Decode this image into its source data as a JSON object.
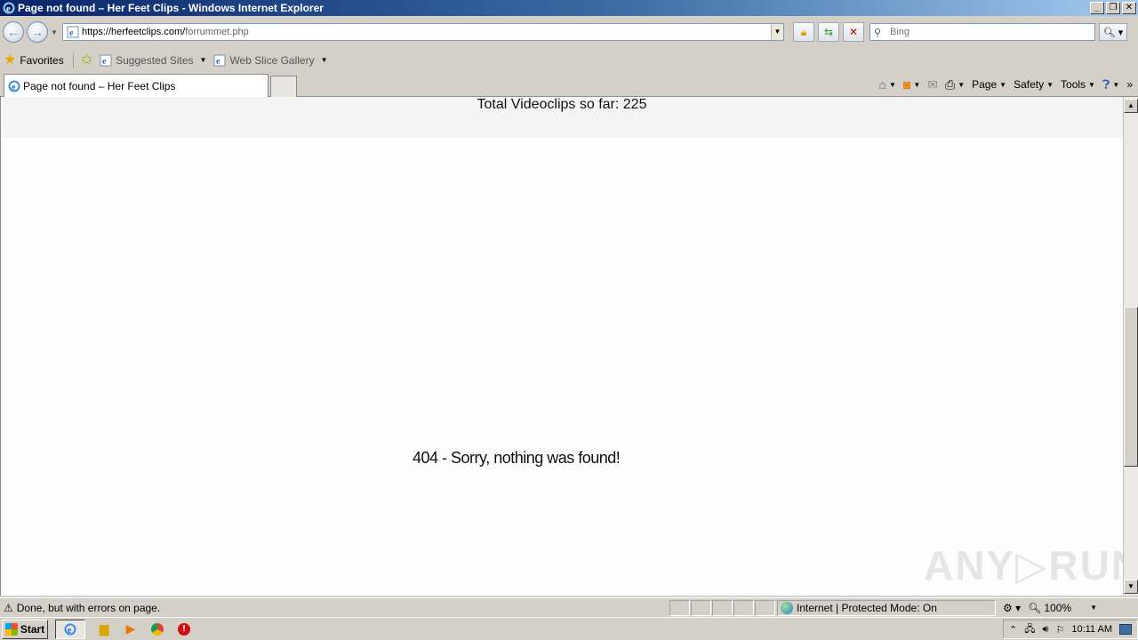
{
  "window": {
    "title": "Page not found – Her Feet Clips - Windows Internet Explorer"
  },
  "address_bar": {
    "url_host": "https://herfeetclips.com/",
    "url_path": "forrummet.php"
  },
  "search": {
    "placeholder": "Bing"
  },
  "favorites_bar": {
    "favorites_label": "Favorites",
    "suggested_sites": "Suggested Sites",
    "web_slice_gallery": "Web Slice Gallery"
  },
  "tab": {
    "title": "Page not found – Her Feet Clips"
  },
  "command_bar": {
    "page": "Page",
    "safety": "Safety",
    "tools": "Tools"
  },
  "content": {
    "total_clips": "Total Videoclips so far: 225",
    "not_found": "404 - Sorry, nothing was found!"
  },
  "watermark": "ANY▷RUN",
  "status_bar": {
    "message": "Done, but with errors on page.",
    "zone": "Internet | Protected Mode: On",
    "zoom": "100%"
  },
  "taskbar": {
    "start": "Start",
    "clock": "10:11 AM"
  },
  "colors": {
    "titlebar_start": "#0a246a",
    "titlebar_end": "#a6caf0",
    "chrome": "#d4d0c8"
  }
}
